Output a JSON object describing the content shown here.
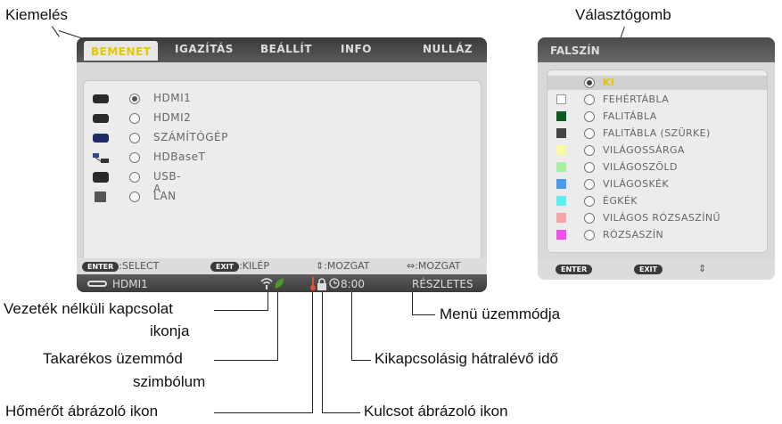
{
  "callouts": {
    "highlight": "Kiemelés",
    "selector": "Választógomb",
    "wireless": "Vezeték nélküli kapcsolat",
    "wireless2": "ikonja",
    "eco": "Takarékos üzemmód",
    "eco2": "szimbólum",
    "thermo": "Hőmérőt ábrázoló ikon",
    "key": "Kulcsot ábrázoló ikon",
    "timer": "Kikapcsolásig hátralévő idő",
    "mode": "Menü üzemmódja"
  },
  "main_menu": {
    "tabs": [
      "BEMENET",
      "IGAZÍTÁS",
      "BEÁLLÍT",
      "INFO",
      "NULLÁZ"
    ],
    "sources": [
      {
        "label": "HDMI1",
        "selected": true
      },
      {
        "label": "HDMI2",
        "selected": false
      },
      {
        "label": "SZÁMÍTÓGÉP",
        "selected": false
      },
      {
        "label": "HDBaseT",
        "selected": false
      },
      {
        "label": "USB-A",
        "selected": false
      },
      {
        "label": "LAN",
        "selected": false
      }
    ],
    "help": {
      "enter_key": "ENTER",
      "enter_text": ":SELECT",
      "exit_key": "EXIT",
      "exit_text": ":KILÉP",
      "updown_text": "⇕:MOZGAT",
      "leftright_text": "⇔:MOZGAT"
    },
    "status": {
      "input": "HDMI1",
      "timer": "8:00",
      "mode": "RÉSZLETES"
    }
  },
  "color_menu": {
    "title": "FALSZÍN",
    "options": [
      {
        "label": "KI",
        "swatch": "",
        "selected": true
      },
      {
        "label": "FEHÉRTÁBLA",
        "swatch": "#ffffff",
        "selected": false
      },
      {
        "label": "FALITÁBLA",
        "swatch": "#0b5a1e",
        "selected": false
      },
      {
        "label": "FALITÁBLA (SZÜRKE)",
        "swatch": "#454545",
        "selected": false
      },
      {
        "label": "VILÁGOSSÁRGA",
        "swatch": "#fafaa5",
        "selected": false
      },
      {
        "label": "VILÁGOSZÖLD",
        "swatch": "#a5f0a5",
        "selected": false
      },
      {
        "label": "VILÁGOSKÉK",
        "swatch": "#4a9bef",
        "selected": false
      },
      {
        "label": "ÉGKÉK",
        "swatch": "#5ef0f0",
        "selected": false
      },
      {
        "label": "VILÁGOS RÓZSASZÍNŰ",
        "swatch": "#f5a5a5",
        "selected": false
      },
      {
        "label": "RÓZSASZÍN",
        "swatch": "#f050f0",
        "selected": false
      }
    ],
    "help": {
      "enter_key": "ENTER",
      "exit_key": "EXIT",
      "updown": "⇕"
    }
  },
  "colors": {
    "accent": "#e3c700",
    "tab_bar": "#4a4a4a",
    "panel": "#ececec"
  }
}
